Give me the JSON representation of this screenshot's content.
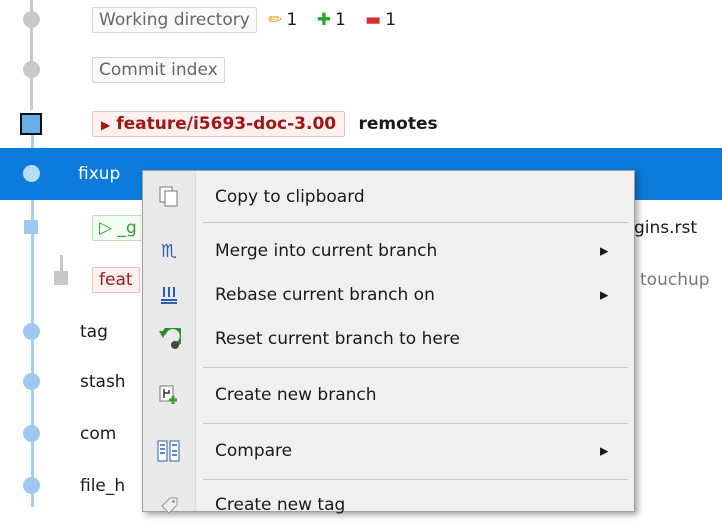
{
  "rows": {
    "working_directory": {
      "label": "Working directory",
      "edits": "1",
      "adds": "1",
      "removes": "1"
    },
    "commit_index": {
      "label": "Commit index"
    },
    "head": {
      "branch": "feature/i5693-doc-3.00",
      "remotes": "remotes"
    },
    "selected": {
      "text": "fixup"
    },
    "r5": {
      "prefix": "_g",
      "suffix": "gins.rst"
    },
    "r6": {
      "prefix": "feat",
      "suffix": "touchup"
    },
    "r7": {
      "text": "tag"
    },
    "r8": {
      "text": "stash"
    },
    "r9": {
      "text": "com"
    },
    "r10": {
      "text": "file_h"
    }
  },
  "menu": {
    "items": [
      {
        "label": "Copy to clipboard",
        "icon": "copy-icon"
      },
      {
        "label": "Merge into current branch",
        "icon": "merge-icon",
        "submenu": true
      },
      {
        "label": "Rebase current branch on",
        "icon": "rebase-icon",
        "submenu": true
      },
      {
        "label": "Reset current branch to here",
        "icon": "reset-icon"
      },
      {
        "label": "Create new branch",
        "icon": "new-branch-icon"
      },
      {
        "label": "Compare",
        "icon": "compare-icon",
        "submenu": true
      },
      {
        "label": "Create new tag",
        "icon": "tag-icon"
      }
    ],
    "arrow": "▶"
  },
  "colors": {
    "selection": "#0c7bdc",
    "graph_line": "#a8cff0",
    "branch_red": "#a11717",
    "menu_bg": "#f0f0f0"
  }
}
